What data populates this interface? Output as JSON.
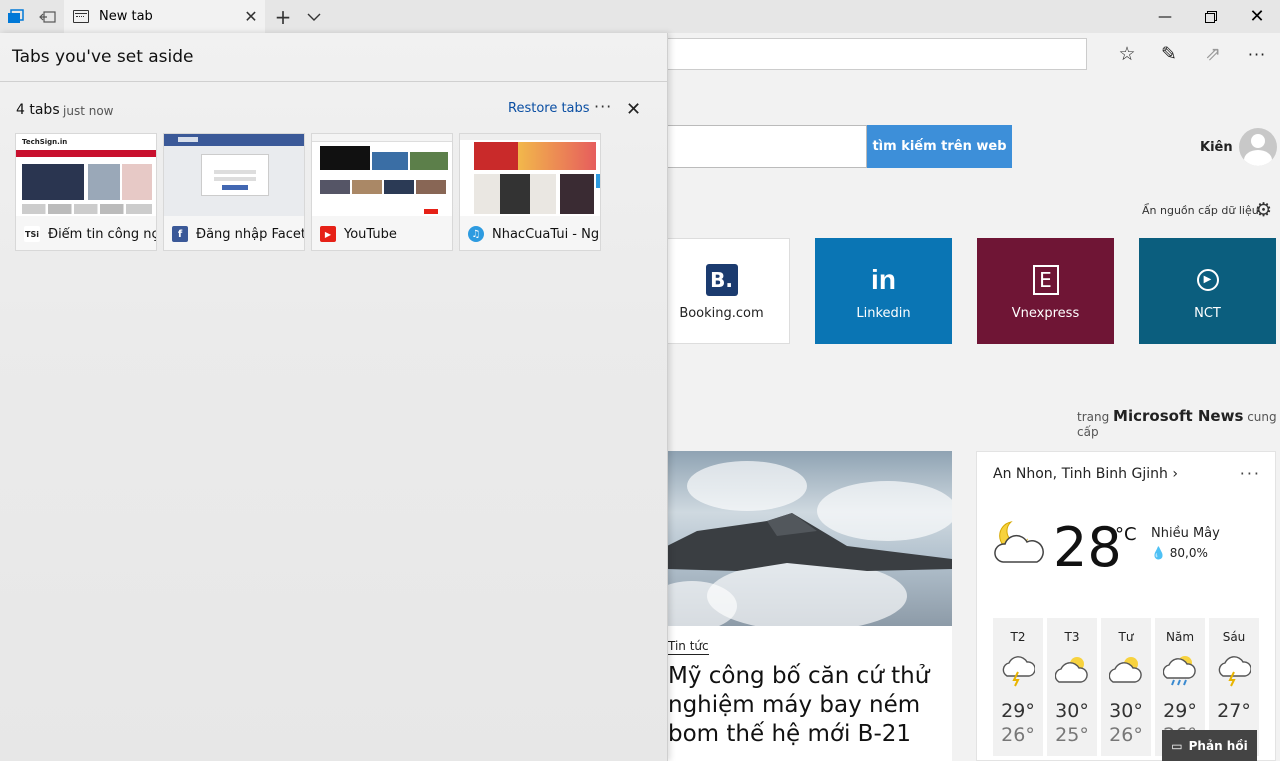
{
  "tabstrip": {
    "tab_title": "New tab"
  },
  "aside": {
    "title": "Tabs you've set aside",
    "group": {
      "count": "4 tabs",
      "time": "just now",
      "restore": "Restore tabs",
      "tabs": [
        {
          "label": "Điểm tin công nç",
          "icon_text": "TSi",
          "icon_color": "#ffffff"
        },
        {
          "label": "Đăng nhập Facet",
          "icon_text": "f",
          "icon_color": "#3b5998"
        },
        {
          "label": "YouTube",
          "icon_text": "▶",
          "icon_color": "#e62117"
        },
        {
          "label": "NhacCuaTui - Ng",
          "icon_text": "♫",
          "icon_color": "#2d9be0"
        }
      ]
    }
  },
  "newtab": {
    "search_button": "tìm kiếm trên web",
    "user_name": "Kiên",
    "hide_feed": "Ẩn nguồn cấp dữ liệu",
    "tiles": [
      {
        "label": "Booking.com",
        "color": "#ffffff"
      },
      {
        "label": "Linkedin",
        "color": "#0a75b4"
      },
      {
        "label": "Vnexpress",
        "color": "#6f1535"
      },
      {
        "label": "NCT",
        "color": "#0b5e7e"
      }
    ],
    "msnews_prefix": "trang",
    "msnews_brand": "Microsoft News",
    "msnews_suffix": "cung cấp",
    "news": {
      "category": "Tin tức",
      "title": "Mỹ công bố căn cứ thử nghiệm máy bay ném bom thế hệ mới B-21"
    },
    "weather": {
      "location": "An Nhon, Tinh Binh Gjinh",
      "temp": "28",
      "unit": "°C",
      "condition": "Nhiều Mây",
      "humidity": "80,0%",
      "days": [
        {
          "name": "T2",
          "hi": "29°",
          "lo": "26°",
          "icon": "rain-thunder-icon"
        },
        {
          "name": "T3",
          "hi": "30°",
          "lo": "25°",
          "icon": "partly-sunny-icon"
        },
        {
          "name": "Tư",
          "hi": "30°",
          "lo": "26°",
          "icon": "partly-sunny-icon"
        },
        {
          "name": "Năm",
          "hi": "29°",
          "lo": "26°",
          "icon": "sun-rain-icon"
        },
        {
          "name": "Sáu",
          "hi": "27°",
          "lo": "",
          "icon": "rain-thunder-icon"
        }
      ]
    },
    "feedback": "Phản hồi"
  }
}
